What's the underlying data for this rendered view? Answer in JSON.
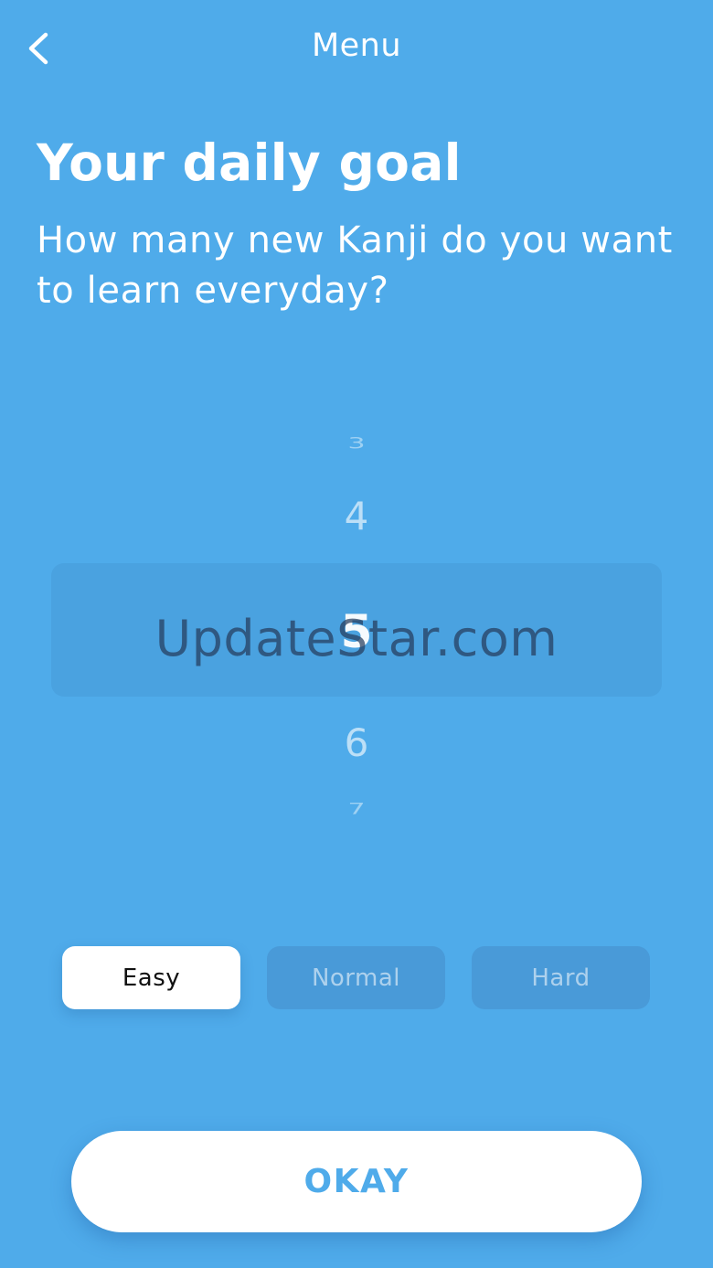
{
  "nav": {
    "title": "Menu",
    "back_icon": "chevron-left-icon"
  },
  "header": {
    "title": "Your daily goal",
    "subtitle": "How many new Kanji do you want to learn everyday?"
  },
  "picker": {
    "values": [
      "3",
      "4",
      "5",
      "6",
      "7"
    ],
    "selected": "5"
  },
  "watermark": "UpdateStar.com",
  "difficulty": {
    "options": [
      "Easy",
      "Normal",
      "Hard"
    ],
    "selected": "Easy"
  },
  "okay_label": "OKAY",
  "colors": {
    "background": "#4fabea",
    "accent": "#4fabea",
    "button_bg": "#ffffff",
    "selected_text": "#111111"
  }
}
